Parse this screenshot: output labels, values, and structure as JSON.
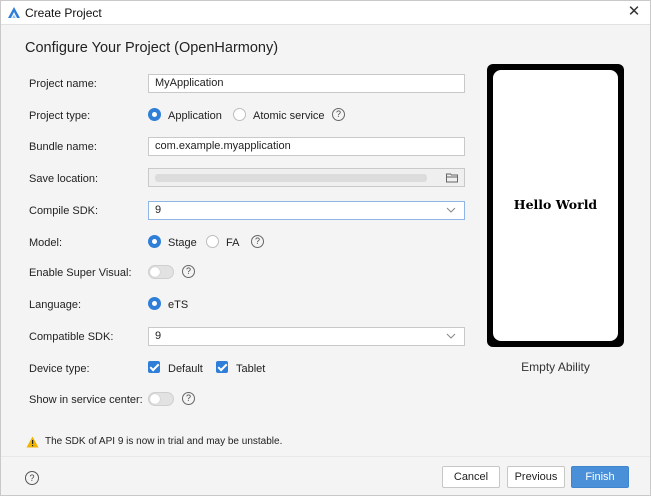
{
  "window": {
    "title": "Create Project",
    "close_glyph": "✕"
  },
  "heading": "Configure Your Project (OpenHarmony)",
  "form": {
    "project_name": {
      "label": "Project name:",
      "value": "MyApplication"
    },
    "project_type": {
      "label": "Project type:",
      "options": [
        "Application",
        "Atomic service"
      ],
      "selected": "Application"
    },
    "bundle_name": {
      "label": "Bundle name:",
      "value": "com.example.myapplication"
    },
    "save_location": {
      "label": "Save location:",
      "value": ""
    },
    "compile_sdk": {
      "label": "Compile SDK:",
      "value": "9"
    },
    "model": {
      "label": "Model:",
      "options": [
        "Stage",
        "FA"
      ],
      "selected": "Stage"
    },
    "super_visual": {
      "label": "Enable Super Visual:",
      "enabled": false
    },
    "language": {
      "label": "Language:",
      "value": "eTS"
    },
    "compatible_sdk": {
      "label": "Compatible SDK:",
      "value": "9"
    },
    "device_type": {
      "label": "Device type:",
      "options": [
        "Default",
        "Tablet"
      ],
      "checked": [
        "Default",
        "Tablet"
      ]
    },
    "service_center": {
      "label": "Show in service center:",
      "enabled": false
    },
    "help_glyph": "?"
  },
  "preview": {
    "screen_text": "Hello World",
    "template_name": "Empty Ability"
  },
  "warning": "The SDK of API 9 is now in trial and may be unstable.",
  "footer": {
    "help_glyph": "?",
    "cancel": "Cancel",
    "previous": "Previous",
    "finish": "Finish"
  },
  "colors": {
    "accent": "#2f7ed8",
    "primary_button": "#4a90d9",
    "warning": "#f0b400"
  },
  "icons": [
    "app-logo-icon",
    "close-icon",
    "help-icon",
    "folder-icon",
    "chevron-down-icon",
    "warning-icon",
    "checkmark-icon"
  ]
}
